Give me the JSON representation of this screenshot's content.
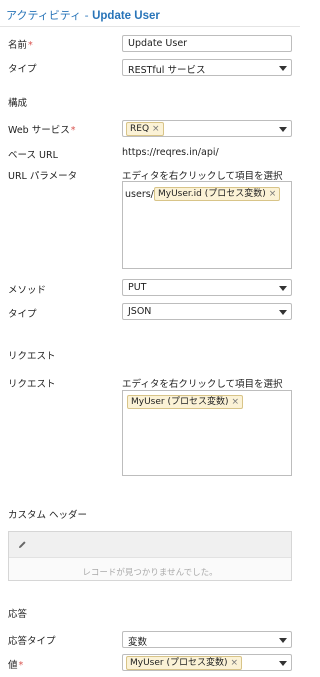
{
  "header": {
    "prefix": "アクティビティ - ",
    "entity": "Update User"
  },
  "fields": {
    "name": {
      "label": "名前",
      "required": "*",
      "value": "Update User"
    },
    "type": {
      "label": "タイプ",
      "value": "RESTful サービス"
    }
  },
  "config": {
    "section": "構成",
    "webservice": {
      "label": "Web サービス",
      "required": "*",
      "tag": "REQ"
    },
    "base_url": {
      "label": "ベース URL",
      "value": "https://reqres.in/api/"
    },
    "url_param": {
      "label": "URL パラメータ",
      "hint": "エディタを右クリックして項目を選択",
      "prefix_text": "users/",
      "tag": "MyUser.id (プロセス変数)"
    },
    "method": {
      "label": "メソッド",
      "value": "PUT"
    },
    "content_type": {
      "label": "タイプ",
      "value": "JSON"
    }
  },
  "request": {
    "section": "リクエスト",
    "label": "リクエスト",
    "hint": "エディタを右クリックして項目を選択",
    "tag": "MyUser (プロセス変数)"
  },
  "custom_header": {
    "section": "カスタム ヘッダー",
    "empty_text": "レコードが見つかりませんでした。",
    "edit_icon": "pencil-icon"
  },
  "response": {
    "section": "応答",
    "type": {
      "label": "応答タイプ",
      "value": "変数"
    },
    "value": {
      "label": "値",
      "required": "*",
      "tag": "MyUser (プロセス変数)"
    }
  },
  "tag_remove_symbol": "×"
}
